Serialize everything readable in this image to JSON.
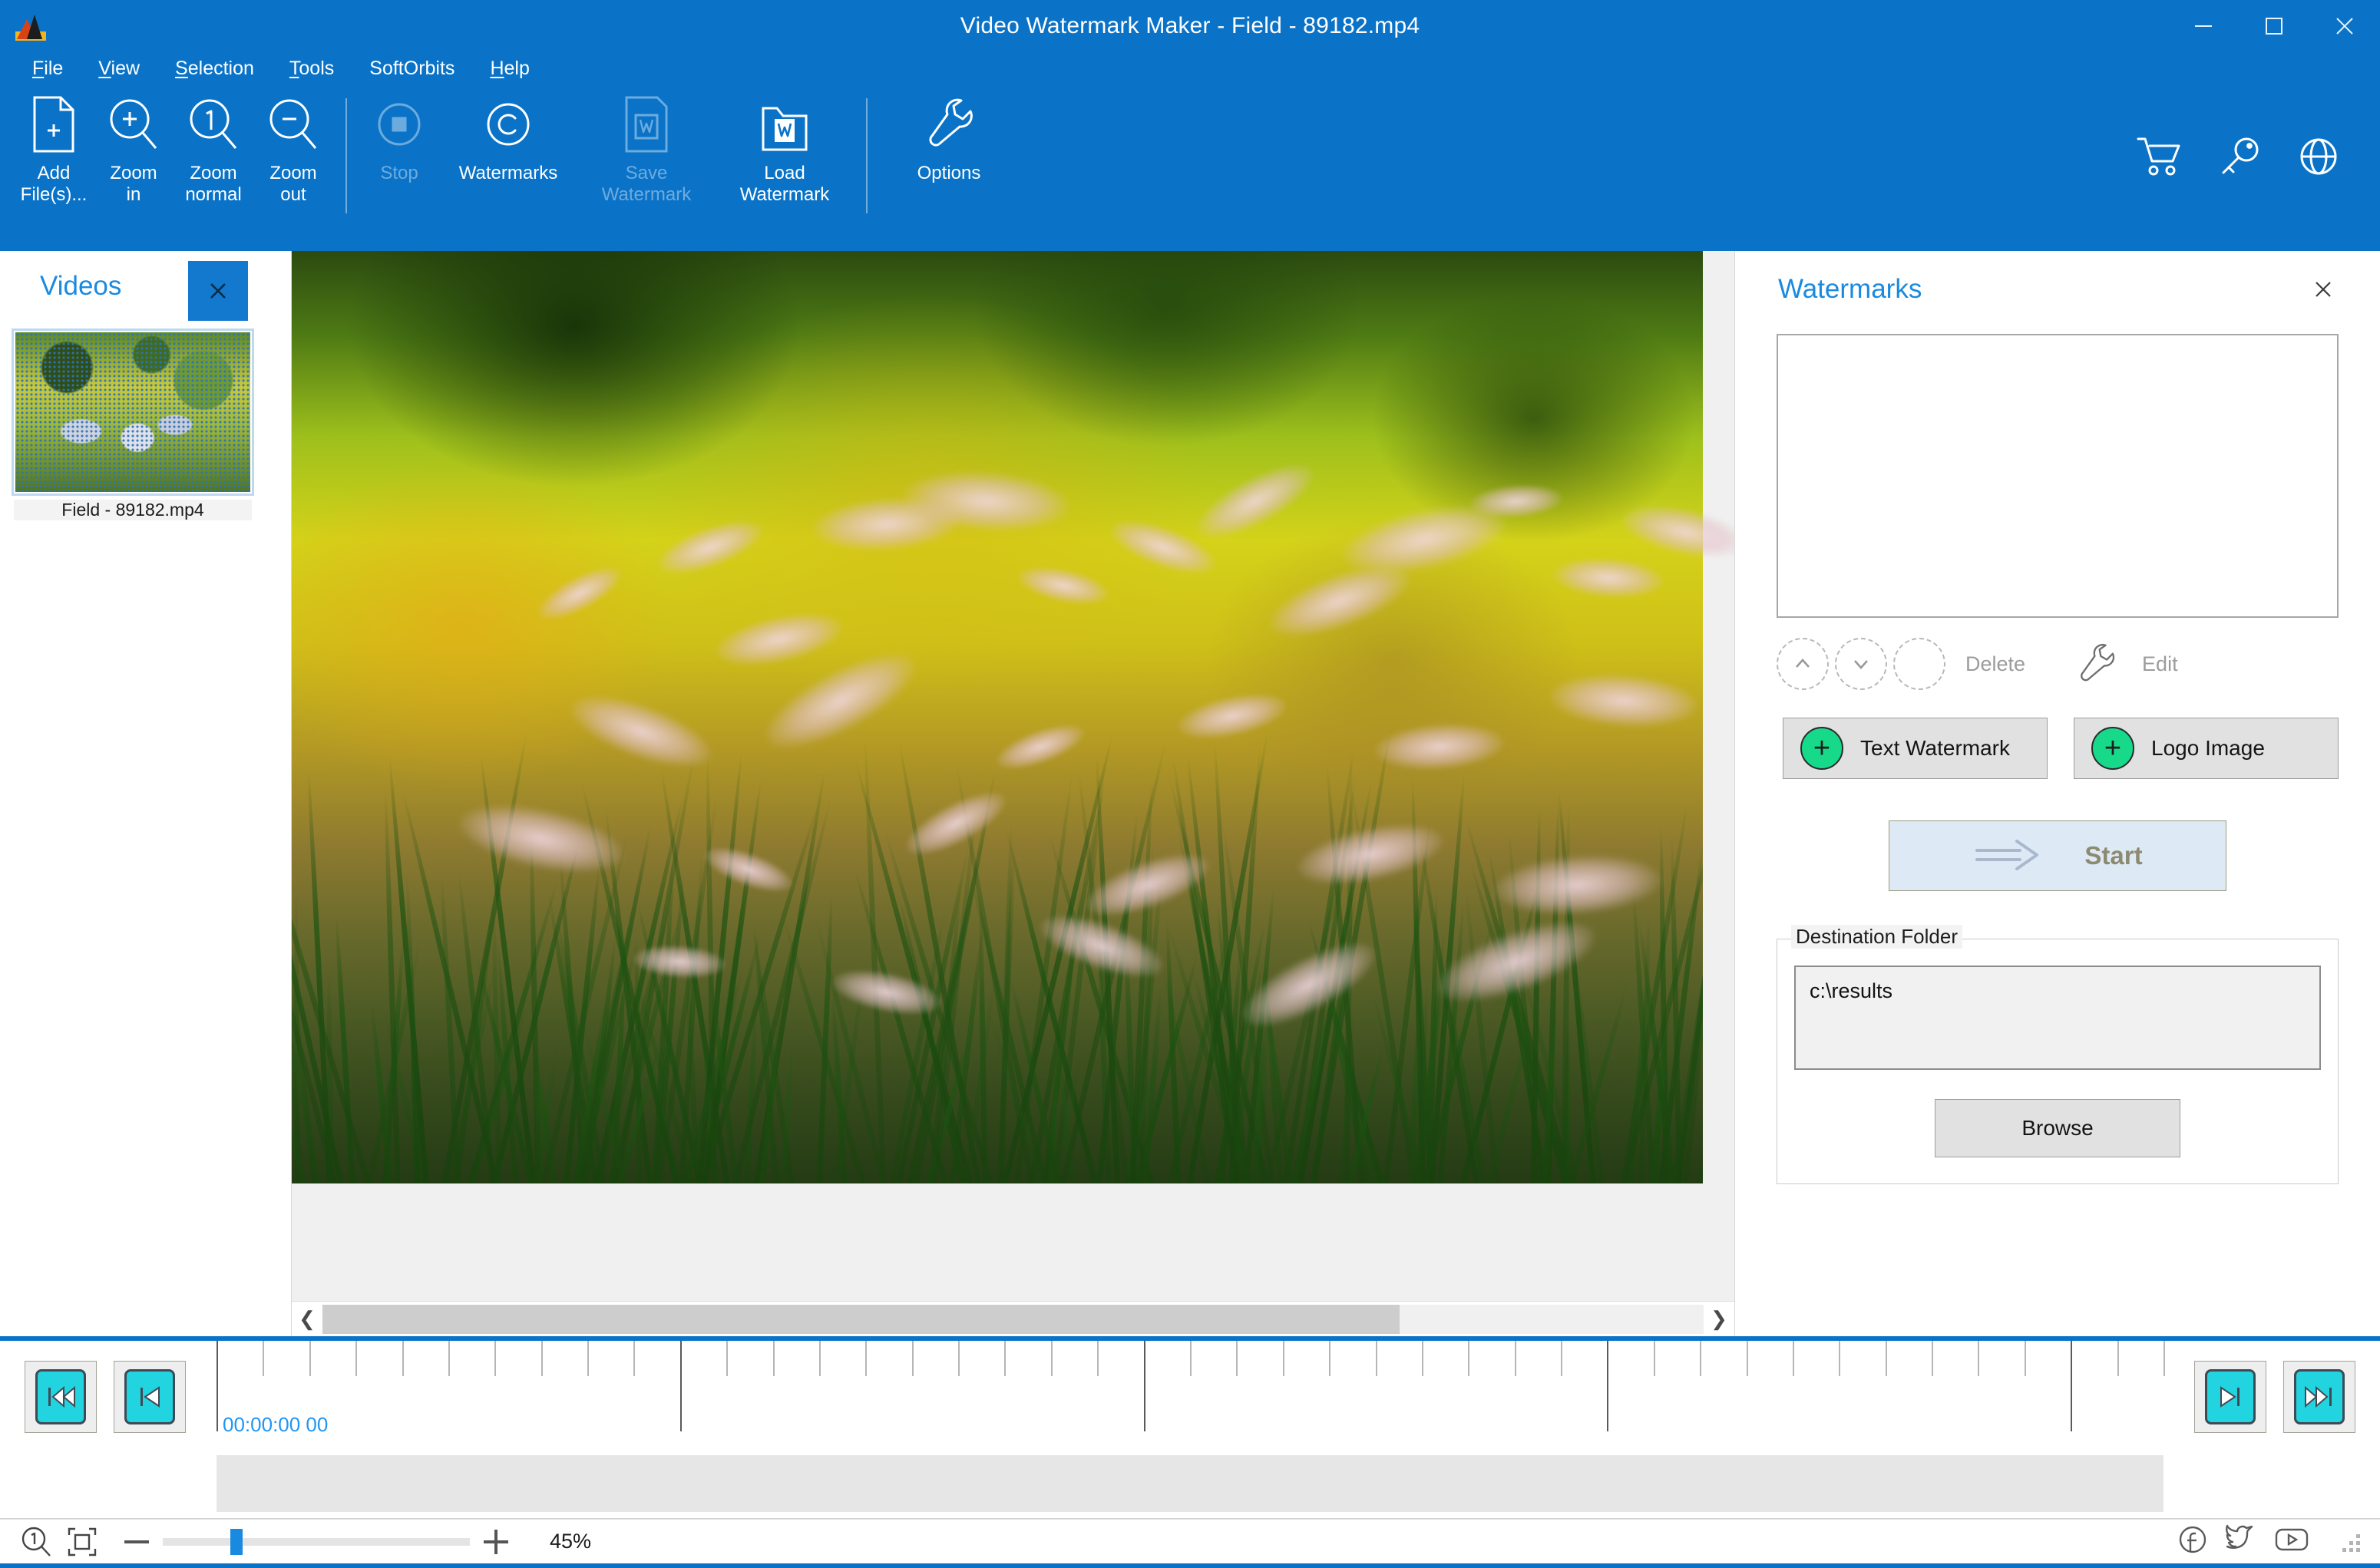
{
  "window": {
    "title": "Video Watermark Maker - Field - 89182.mp4",
    "app_icon": "mountain-flag-icon",
    "controls": {
      "minimize": "minimize-icon",
      "maximize": "maximize-icon",
      "close": "close-icon"
    }
  },
  "menu": {
    "items": [
      {
        "label": "File",
        "accel": "F"
      },
      {
        "label": "View",
        "accel": "V"
      },
      {
        "label": "Selection",
        "accel": "S"
      },
      {
        "label": "Tools",
        "accel": "T"
      },
      {
        "label": "SoftOrbits",
        "accel": ""
      },
      {
        "label": "Help",
        "accel": "H"
      }
    ]
  },
  "toolbar": {
    "buttons": [
      {
        "label": "Add\nFile(s)...",
        "icon": "add-file-icon",
        "disabled": false
      },
      {
        "label": "Zoom\nin",
        "icon": "zoom-in-icon",
        "disabled": false
      },
      {
        "label": "Zoom\nnormal",
        "icon": "zoom-normal-icon",
        "disabled": false
      },
      {
        "label": "Zoom\nout",
        "icon": "zoom-out-icon",
        "disabled": false
      },
      {
        "label": "Stop",
        "icon": "stop-icon",
        "disabled": true
      },
      {
        "label": "Watermarks",
        "icon": "copyright-icon",
        "disabled": false
      },
      {
        "label": "Save\nWatermark",
        "icon": "save-watermark-icon",
        "disabled": true
      },
      {
        "label": "Load\nWatermark",
        "icon": "load-watermark-icon",
        "disabled": false
      },
      {
        "label": "Options",
        "icon": "wrench-icon",
        "disabled": false
      }
    ],
    "right_icons": [
      {
        "name": "cart-icon"
      },
      {
        "name": "key-icon"
      },
      {
        "name": "globe-icon"
      }
    ]
  },
  "videos_panel": {
    "title": "Videos",
    "close_icon": "close-icon",
    "items": [
      {
        "filename": "Field - 89182.mp4",
        "thumbnail": "video-thumbnail"
      }
    ]
  },
  "preview": {
    "scrollbar": {
      "left_arrow": "chevron-left-icon",
      "right_arrow": "chevron-right-icon",
      "thumb_percent": 78
    }
  },
  "watermarks_panel": {
    "title": "Watermarks",
    "close_icon": "close-icon",
    "list_items": [],
    "actions": {
      "move_up_icon": "chevron-up-icon",
      "move_down_icon": "chevron-down-icon",
      "delete_icon": "delete-circle-icon",
      "delete_label": "Delete",
      "edit_icon": "wrench-icon",
      "edit_label": "Edit"
    },
    "add_buttons": [
      {
        "label": "Text Watermark",
        "icon": "plus-circle-icon"
      },
      {
        "label": "Logo Image",
        "icon": "plus-circle-icon"
      }
    ],
    "start": {
      "label": "Start",
      "icon": "arrow-right-icon"
    },
    "destination": {
      "legend": "Destination Folder",
      "path": "c:\\results",
      "browse_label": "Browse"
    }
  },
  "timeline": {
    "nav_left": [
      {
        "name": "skip-to-start-button",
        "icon": "skip-back-icon"
      },
      {
        "name": "step-back-button",
        "icon": "step-back-icon"
      }
    ],
    "nav_right": [
      {
        "name": "step-forward-button",
        "icon": "step-forward-icon"
      },
      {
        "name": "skip-to-end-button",
        "icon": "skip-forward-icon"
      }
    ],
    "timecode": "00:00:00 00",
    "tick_count": 42,
    "major_every": 10
  },
  "statusbar": {
    "zoom_normal_icon": "zoom-one-icon",
    "fit_icon": "fit-to-window-icon",
    "minus_icon": "minus-icon",
    "plus_icon": "plus-icon",
    "zoom_percent": "45%",
    "zoom_slider_value": 45,
    "social": [
      {
        "name": "facebook-icon"
      },
      {
        "name": "twitter-icon"
      },
      {
        "name": "youtube-icon"
      }
    ],
    "resize_grip": "resize-grip-icon"
  },
  "colors": {
    "titlebar_blue": "#0a73c8",
    "accent_blue": "#1a8ae0",
    "green_plus": "#17d98a",
    "cyan_button": "#22d3e0",
    "start_bg": "#ddeaf6"
  }
}
